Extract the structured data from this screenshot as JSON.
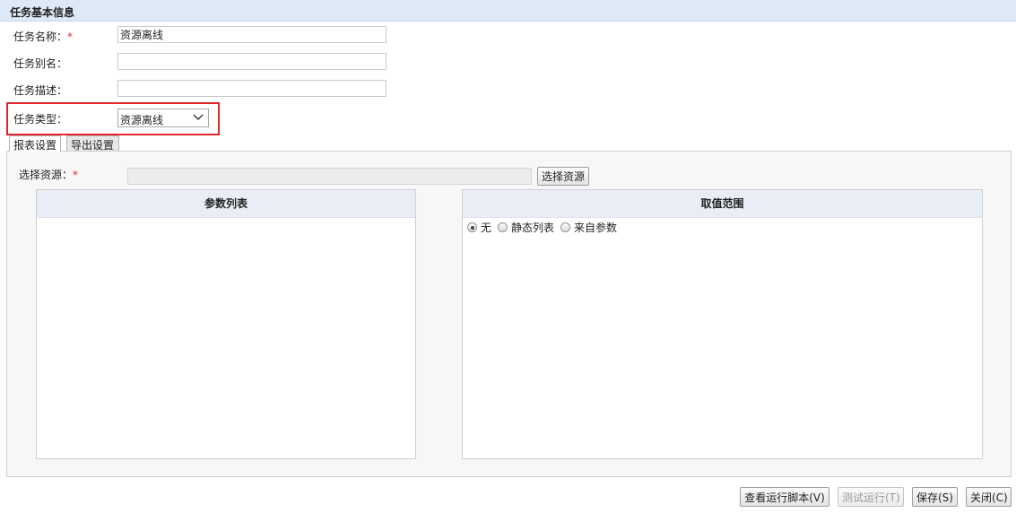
{
  "section": {
    "title": "任务基本信息"
  },
  "form": {
    "name_label": "任务名称：",
    "required_mark": "*",
    "name_value": "资源离线",
    "alias_label": "任务别名：",
    "alias_value": "",
    "desc_label": "任务描述：",
    "desc_value": "",
    "type_label": "任务类型：",
    "type_value": "资源离线"
  },
  "tabs": [
    {
      "label": "报表设置",
      "active": true
    },
    {
      "label": "导出设置",
      "active": false
    }
  ],
  "report": {
    "resource_label": "选择资源：",
    "resource_value": "",
    "select_button": "选择资源",
    "param_list_header": "参数列表",
    "range_header": "取值范围",
    "range_options": [
      {
        "label": "无",
        "checked": true
      },
      {
        "label": "静态列表",
        "checked": false
      },
      {
        "label": "来自参数",
        "checked": false
      }
    ]
  },
  "footer": {
    "view_script": "查看运行脚本(V)",
    "test_run": "测试运行(T)",
    "save": "保存(S)",
    "close": "关闭(C)"
  },
  "colors": {
    "header_bg": "#dde9f7",
    "highlight": "#e0262a",
    "required": "#e0302e"
  }
}
